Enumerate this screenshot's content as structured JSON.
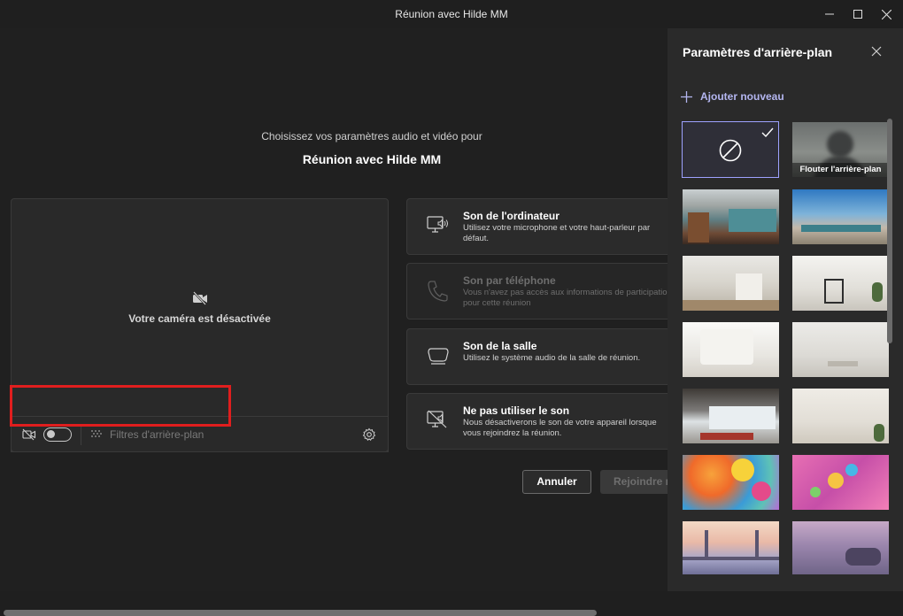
{
  "window": {
    "title": "Réunion avec Hilde MM"
  },
  "prejoin": {
    "subtitle": "Choisissez vos paramètres audio et vidéo pour",
    "meeting_name": "Réunion avec Hilde MM",
    "camera_off_text": "Votre caméra est désactivée",
    "camera_toggle_on": false,
    "background_filters_label": "Filtres d'arrière-plan"
  },
  "audio_options": [
    {
      "title": "Son de l'ordinateur",
      "desc": "Utilisez votre microphone et votre haut-parleur par défaut.",
      "icon": "computer-speaker-icon",
      "disabled": false
    },
    {
      "title": "Son par téléphone",
      "desc": "Vous n'avez pas accès aux informations de participation pour cette réunion",
      "icon": "phone-icon",
      "disabled": true
    },
    {
      "title": "Son de la salle",
      "desc": "Utilisez le système audio de la salle de réunion.",
      "icon": "room-audio-icon",
      "disabled": false
    },
    {
      "title": "Ne pas utiliser le son",
      "desc": "Nous désactiverons le son de votre appareil lorsque vous rejoindrez la réunion.",
      "icon": "no-audio-icon",
      "disabled": false
    }
  ],
  "buttons": {
    "cancel": "Annuler",
    "join": "Rejoindre m"
  },
  "background_panel": {
    "title": "Paramètres d'arrière-plan",
    "add_new": "Ajouter nouveau",
    "blur_label": "Flouter l'arrière-plan",
    "selected": "none"
  },
  "colors": {
    "accent": "#9ea2ff",
    "highlight": "#e01e1e",
    "link": "#b4b6f0"
  }
}
